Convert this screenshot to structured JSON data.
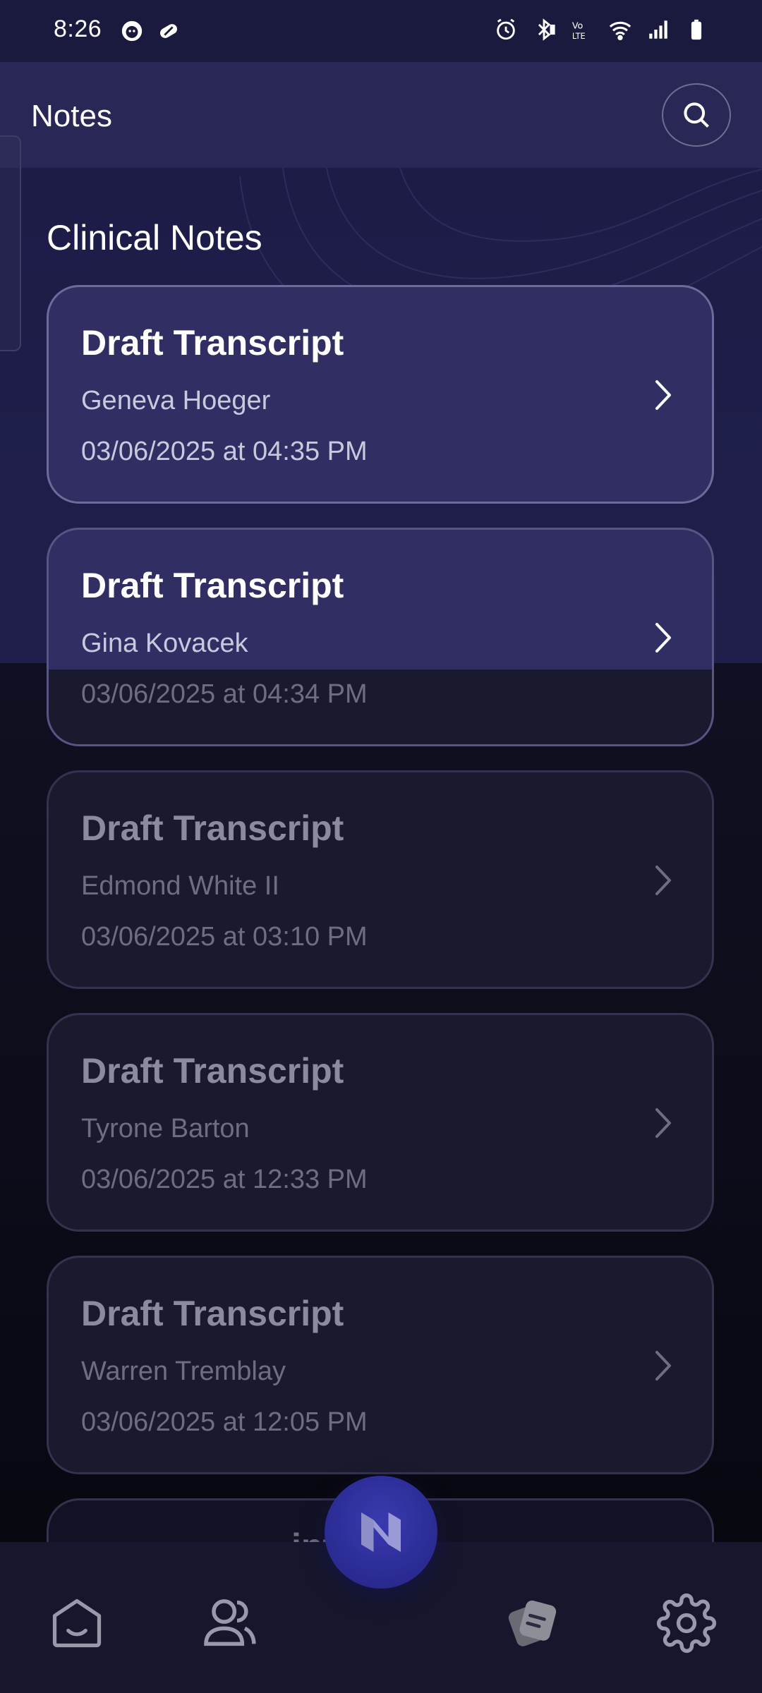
{
  "status_bar": {
    "time": "8:26",
    "left_icons": [
      "face-icon",
      "pill-icon"
    ],
    "right_icons": [
      "alarm-icon",
      "bluetooth-icon",
      "volte-icon",
      "wifi-icon",
      "signal-icon",
      "battery-icon"
    ]
  },
  "app_bar": {
    "title": "Notes",
    "search_icon": "search-icon"
  },
  "section_title": "Clinical Notes",
  "notes": [
    {
      "title": "Draft Transcript",
      "name": "Geneva Hoeger",
      "date": "03/06/2025 at 04:35 PM"
    },
    {
      "title": "Draft Transcript",
      "name": "Gina Kovacek",
      "date": "03/06/2025 at 04:34 PM"
    },
    {
      "title": "Draft Transcript",
      "name": "Edmond White II",
      "date": "03/06/2025 at 03:10 PM"
    },
    {
      "title": "Draft Transcript",
      "name": "Tyrone Barton",
      "date": "03/06/2025 at 12:33 PM"
    },
    {
      "title": "Draft Transcript",
      "name": "Warren Tremblay",
      "date": "03/06/2025 at 12:05 PM"
    }
  ],
  "peek_card_text": "int",
  "bottom_nav": [
    {
      "icon": "home-icon"
    },
    {
      "icon": "users-icon"
    },
    {
      "icon": "notes-icon",
      "active": true
    },
    {
      "icon": "gear-icon"
    }
  ],
  "fab_icon": "n-logo-icon",
  "colors": {
    "header_bg": "#282755",
    "card_active": "#302e62",
    "card_dim": "#1a1a2e",
    "fab": "#2a2a92"
  }
}
